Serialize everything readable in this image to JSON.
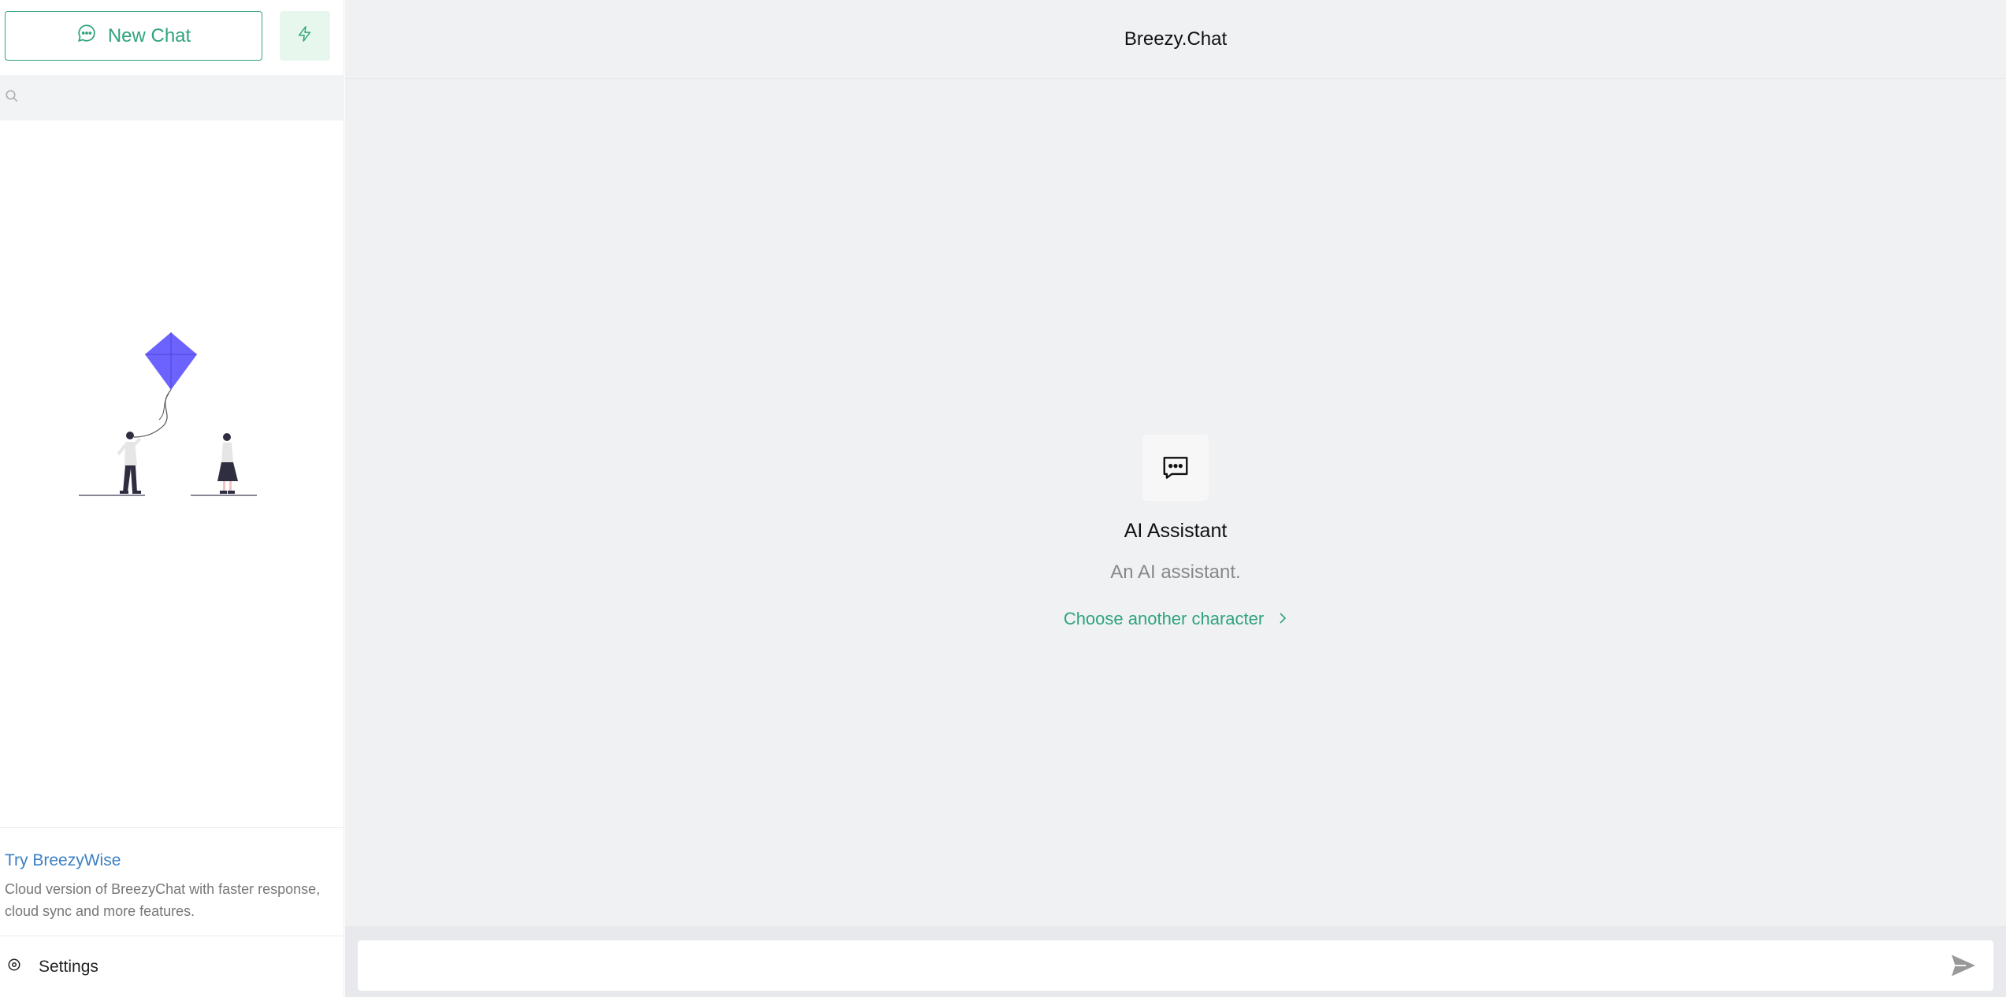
{
  "sidebar": {
    "new_chat_label": "New Chat",
    "search_placeholder": "",
    "promo_title": "Try BreezyWise",
    "promo_description": "Cloud version of BreezyChat with faster response, cloud sync and more features.",
    "settings_label": "Settings"
  },
  "header": {
    "title": "Breezy.Chat"
  },
  "character": {
    "name": "AI Assistant",
    "description": "An AI assistant.",
    "choose_label": "Choose another character"
  },
  "composer": {
    "placeholder": ""
  },
  "colors": {
    "accent": "#2fa37d",
    "link": "#3b7fc4",
    "kite": "#6c63ff",
    "main_bg": "#f0f1f3"
  },
  "icons": {
    "new_chat": "chat-bubble-icon",
    "quick": "lightning-icon",
    "search": "search-icon",
    "settings": "gear-icon",
    "character": "chat-dots-icon",
    "chevron": "chevron-right-icon",
    "send": "send-icon"
  }
}
